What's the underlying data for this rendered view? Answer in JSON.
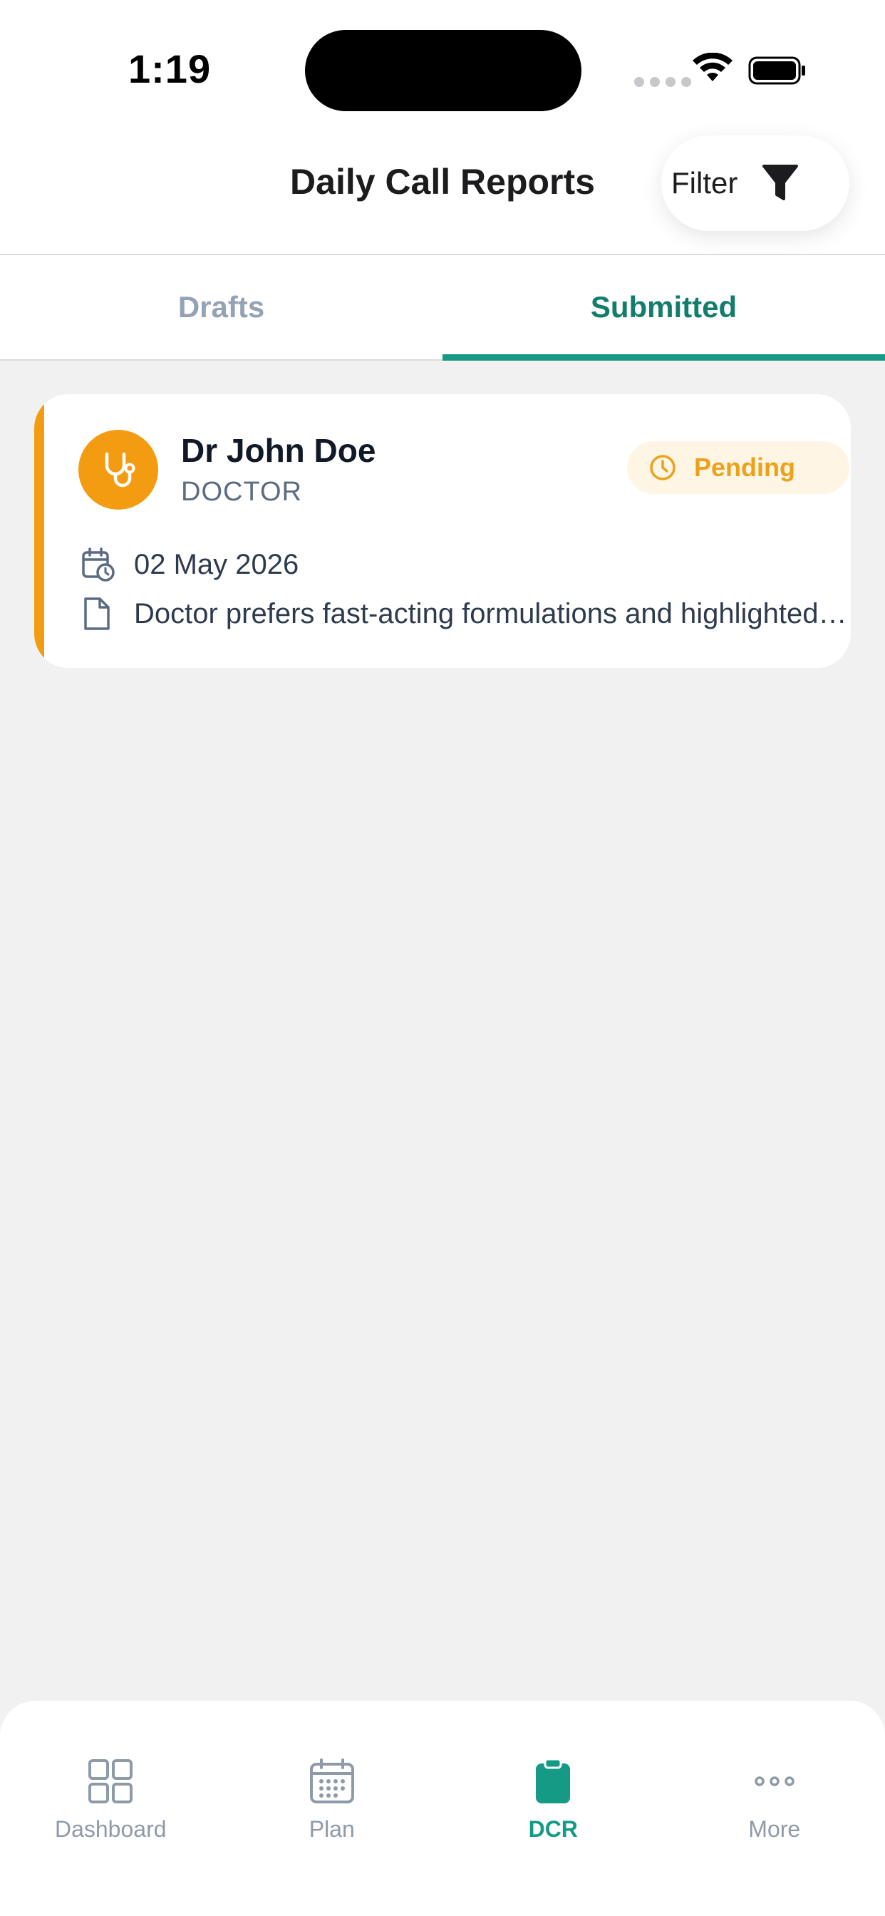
{
  "status_bar": {
    "time": "1:19"
  },
  "header": {
    "title": "Daily Call Reports",
    "filter_label": "Filter"
  },
  "tabs": [
    {
      "label": "Drafts",
      "active": false
    },
    {
      "label": "Submitted",
      "active": true
    }
  ],
  "reports": [
    {
      "name": "Dr John Doe",
      "role": "DOCTOR",
      "status": "Pending",
      "date": "02 May 2026",
      "note": "Doctor prefers fast-acting formulations and highlighted patient compliance"
    }
  ],
  "bottom_nav": [
    {
      "label": "Dashboard",
      "icon": "grid-icon",
      "active": false
    },
    {
      "label": "Plan",
      "icon": "calendar-icon",
      "active": false
    },
    {
      "label": "DCR",
      "icon": "clipboard-icon",
      "active": true
    },
    {
      "label": "More",
      "icon": "more-dots-icon",
      "active": false
    }
  ],
  "colors": {
    "accent_teal": "#159a86",
    "pending_orange": "#f39c12",
    "background": "#f1f1f1"
  }
}
